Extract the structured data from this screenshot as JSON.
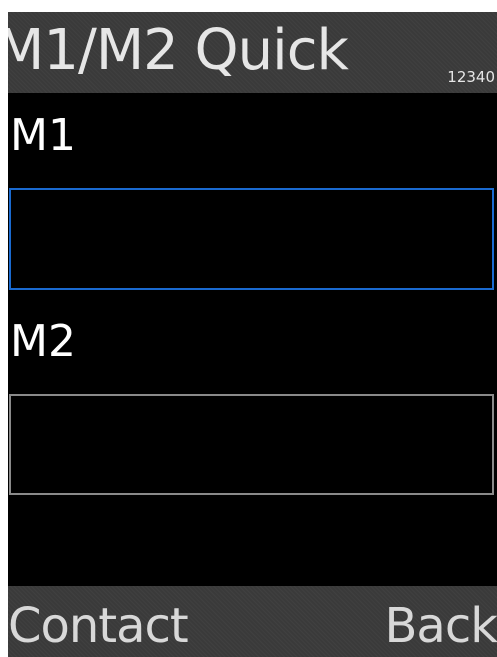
{
  "title_bar": {
    "title": "M1/M2 Quick",
    "input_mode": "12340"
  },
  "fields": {
    "m1": {
      "label": "M1",
      "value": ""
    },
    "m2": {
      "label": "M2",
      "value": ""
    }
  },
  "softkeys": {
    "left": "Contact",
    "right": "Back"
  },
  "colors": {
    "focus_border": "#1a6ad0",
    "field_border": "#8a8a8a",
    "bar_background": "#3a3a3a",
    "screen_background": "#000000"
  }
}
